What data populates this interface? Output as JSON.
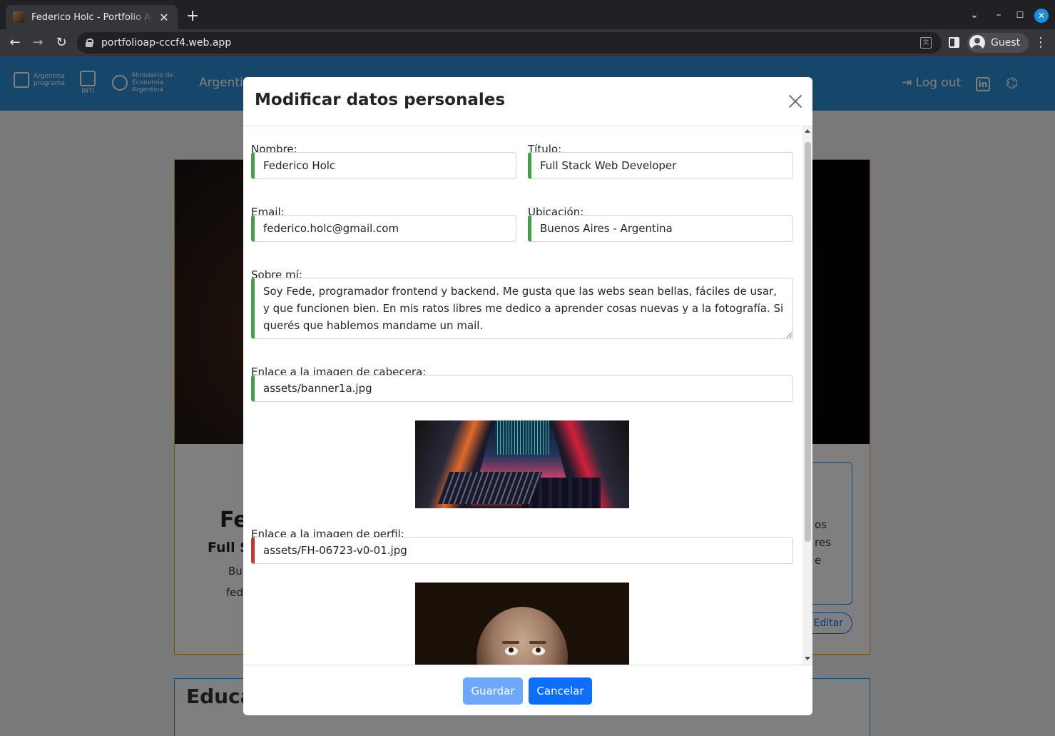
{
  "browser": {
    "tab_title": "Federico Holc - Portfolio Argentina Programa",
    "tab_close": "✕",
    "new_tab": "+",
    "url": "portfolioap-cccf4.web.app",
    "profile_label": "Guest",
    "controls": {
      "tab_search": "⌄",
      "minimize": "–",
      "maximize": "☐",
      "close": "✕",
      "back": "←",
      "forward": "→",
      "reload": "↻",
      "menu": "⋮"
    }
  },
  "site_nav": {
    "logo_ap": "Argentina programa",
    "logo_inti": "INTI",
    "logo_ministerio": "Ministerio de Economía Argentina",
    "brand": "Argentin",
    "logout": "Log out",
    "linkedin": "in",
    "github": "⌬"
  },
  "background_page": {
    "name_fragment": "Fe",
    "title_fragment": "Full S",
    "location_fragment": "Bu",
    "email_fragment": "fed",
    "about_fragments": [
      "os",
      "res",
      "e"
    ],
    "edit_label": "Editar",
    "education_fragment": "Educa"
  },
  "modal": {
    "title": "Modificar datos personales",
    "fields": {
      "nombre": {
        "label": "Nombre:",
        "value": "Federico Holc"
      },
      "titulo": {
        "label": "Título:",
        "value": "Full Stack Web Developer"
      },
      "email": {
        "label": "Email:",
        "value": "federico.holc@gmail.com"
      },
      "ubicacion": {
        "label": "Ubicación:",
        "value": "Buenos Aires - Argentina"
      },
      "sobre_mi": {
        "label": "Sobre mí:",
        "value": "Soy Fede, programador frontend y backend. Me gusta que las webs sean bellas, fáciles de usar, y que funcionen bien. En mis ratos libres me dedico a aprender cosas nuevas y a la fotografía. Si querés que hablemos mandame un mail."
      },
      "banner_url": {
        "label": "Enlace a la imagen de cabecera:",
        "value": "assets/banner1a.jpg"
      },
      "profile_url": {
        "label": "Enlace a la imagen de perfil:",
        "value": "assets/FH-06723-v0-01.jpg"
      }
    },
    "buttons": {
      "save": "Guardar",
      "cancel": "Cancelar"
    }
  },
  "colors": {
    "valid_border": "#43a047",
    "invalid_border": "#c0392b",
    "primary": "#0d6efd",
    "primary_disabled": "#6ea8fe",
    "site_nav": "#2d8fd5"
  }
}
